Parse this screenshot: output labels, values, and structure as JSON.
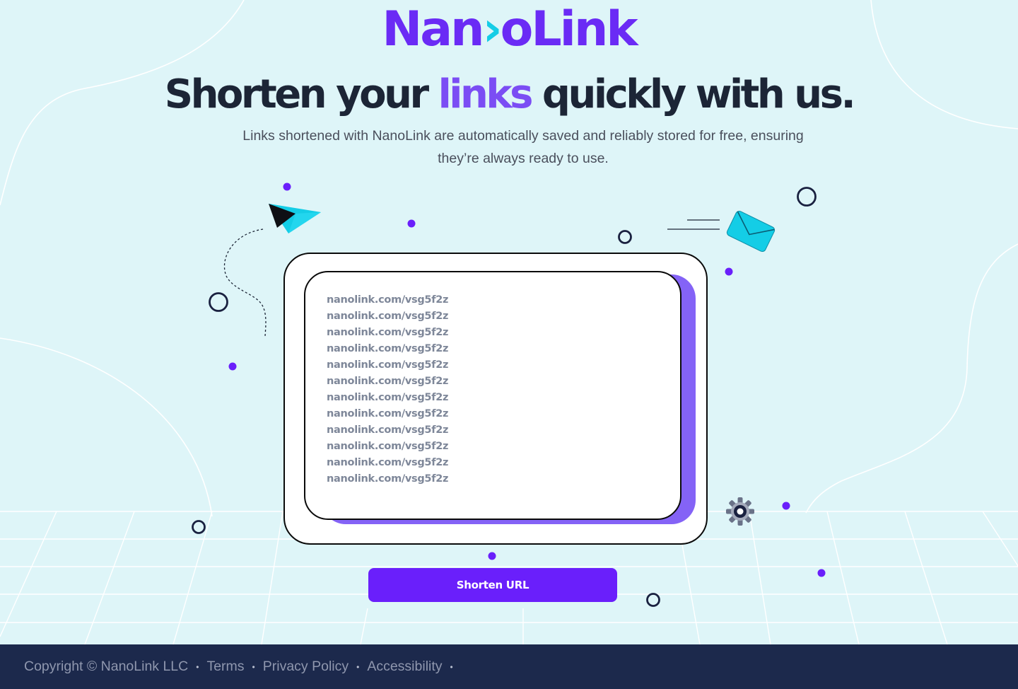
{
  "brand": {
    "name_left": "Nan",
    "name_right": "oLink",
    "name_full": "NanoLink",
    "primary_color": "#6a2bf5",
    "accent_color": "#14cde6"
  },
  "hero": {
    "headline_before": "Shorten your ",
    "headline_highlight": "links",
    "headline_after": " quickly with us.",
    "subtitle": "Links shortened with NanoLink are automatically saved and reliably stored for free, ensuring they’re always ready to use."
  },
  "links": [
    "nanolink.com/vsg5f2z",
    "nanolink.com/vsg5f2z",
    "nanolink.com/vsg5f2z",
    "nanolink.com/vsg5f2z",
    "nanolink.com/vsg5f2z",
    "nanolink.com/vsg5f2z",
    "nanolink.com/vsg5f2z",
    "nanolink.com/vsg5f2z",
    "nanolink.com/vsg5f2z",
    "nanolink.com/vsg5f2z",
    "nanolink.com/vsg5f2z",
    "nanolink.com/vsg5f2z"
  ],
  "action": {
    "shorten_label": "Shorten URL",
    "button_color": "#6a1ffb"
  },
  "decorations": {
    "icons": [
      "paper-plane-icon",
      "envelope-icon",
      "gear-icon"
    ]
  },
  "footer": {
    "copyright": "Copyright © NanoLink LLC",
    "links": [
      "Terms",
      "Privacy Policy",
      "Accessibility"
    ],
    "background": "#1c294c"
  }
}
